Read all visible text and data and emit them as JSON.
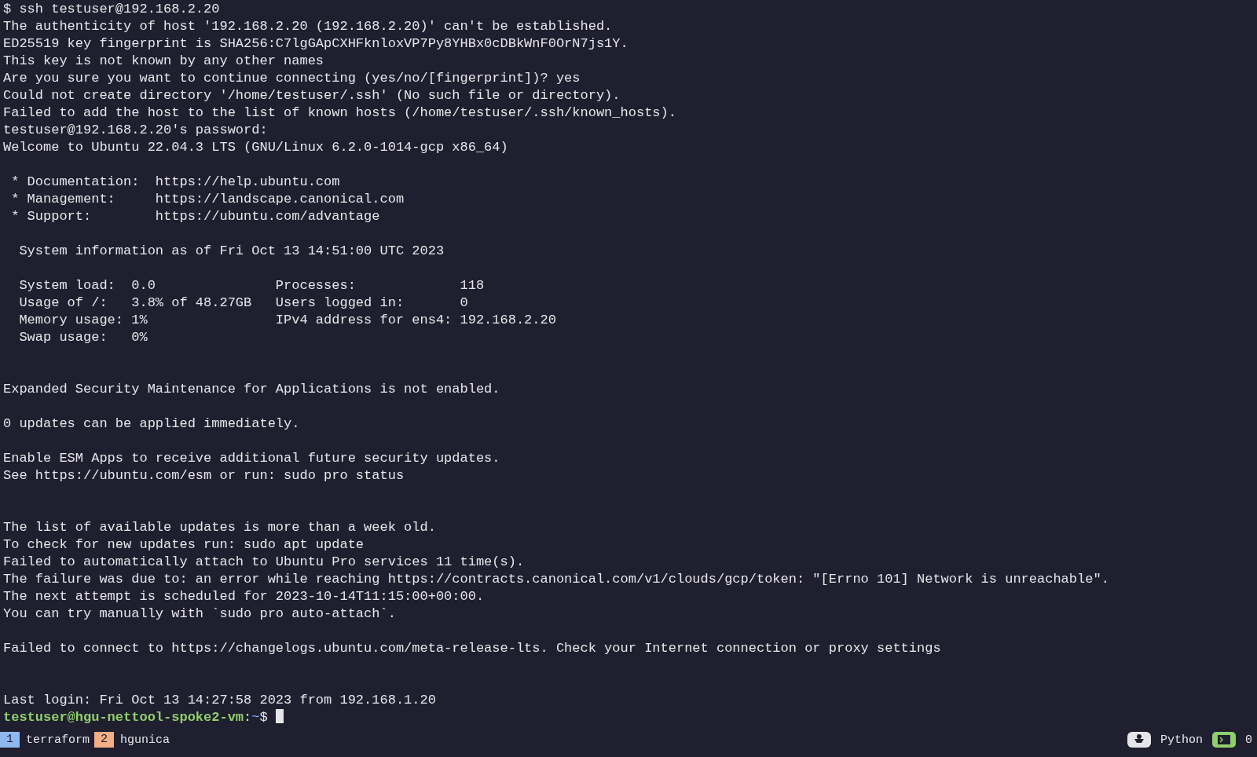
{
  "terminal": {
    "lines": [
      {
        "kind": "output",
        "text": "$ ssh testuser@192.168.2.20"
      },
      {
        "kind": "output",
        "text": "The authenticity of host '192.168.2.20 (192.168.2.20)' can't be established."
      },
      {
        "kind": "output",
        "text": "ED25519 key fingerprint is SHA256:C7lgGApCXHFknloxVP7Py8YHBx0cDBkWnF0OrN7js1Y."
      },
      {
        "kind": "output",
        "text": "This key is not known by any other names"
      },
      {
        "kind": "output",
        "text": "Are you sure you want to continue connecting (yes/no/[fingerprint])? yes"
      },
      {
        "kind": "output",
        "text": "Could not create directory '/home/testuser/.ssh' (No such file or directory)."
      },
      {
        "kind": "output",
        "text": "Failed to add the host to the list of known hosts (/home/testuser/.ssh/known_hosts)."
      },
      {
        "kind": "output",
        "text": "testuser@192.168.2.20's password:"
      },
      {
        "kind": "output",
        "text": "Welcome to Ubuntu 22.04.3 LTS (GNU/Linux 6.2.0-1014-gcp x86_64)"
      },
      {
        "kind": "blank"
      },
      {
        "kind": "output",
        "text": " * Documentation:  https://help.ubuntu.com"
      },
      {
        "kind": "output",
        "text": " * Management:     https://landscape.canonical.com"
      },
      {
        "kind": "output",
        "text": " * Support:        https://ubuntu.com/advantage"
      },
      {
        "kind": "blank"
      },
      {
        "kind": "output",
        "text": "  System information as of Fri Oct 13 14:51:00 UTC 2023"
      },
      {
        "kind": "blank"
      },
      {
        "kind": "output",
        "text": "  System load:  0.0               Processes:             118"
      },
      {
        "kind": "output",
        "text": "  Usage of /:   3.8% of 48.27GB   Users logged in:       0"
      },
      {
        "kind": "output",
        "text": "  Memory usage: 1%                IPv4 address for ens4: 192.168.2.20"
      },
      {
        "kind": "output",
        "text": "  Swap usage:   0%"
      },
      {
        "kind": "blank"
      },
      {
        "kind": "blank"
      },
      {
        "kind": "output",
        "text": "Expanded Security Maintenance for Applications is not enabled."
      },
      {
        "kind": "blank"
      },
      {
        "kind": "output",
        "text": "0 updates can be applied immediately."
      },
      {
        "kind": "blank"
      },
      {
        "kind": "output",
        "text": "Enable ESM Apps to receive additional future security updates."
      },
      {
        "kind": "output",
        "text": "See https://ubuntu.com/esm or run: sudo pro status"
      },
      {
        "kind": "blank"
      },
      {
        "kind": "blank"
      },
      {
        "kind": "output",
        "text": "The list of available updates is more than a week old."
      },
      {
        "kind": "output",
        "text": "To check for new updates run: sudo apt update"
      },
      {
        "kind": "output",
        "text": "Failed to automatically attach to Ubuntu Pro services 11 time(s)."
      },
      {
        "kind": "output",
        "text": "The failure was due to: an error while reaching https://contracts.canonical.com/v1/clouds/gcp/token: \"[Errno 101] Network is unreachable\"."
      },
      {
        "kind": "output",
        "text": "The next attempt is scheduled for 2023-10-14T11:15:00+00:00."
      },
      {
        "kind": "output",
        "text": "You can try manually with `sudo pro auto-attach`."
      },
      {
        "kind": "blank"
      },
      {
        "kind": "output",
        "text": "Failed to connect to https://changelogs.ubuntu.com/meta-release-lts. Check your Internet connection or proxy settings"
      },
      {
        "kind": "blank"
      },
      {
        "kind": "blank"
      },
      {
        "kind": "output",
        "text": "Last login: Fri Oct 13 14:27:58 2023 from 192.168.1.20"
      },
      {
        "kind": "prompt",
        "user_host": "testuser@hgu-nettool-spoke2-vm",
        "separator": ":",
        "path": "~",
        "symbol": "$"
      }
    ]
  },
  "status_bar": {
    "windows": [
      {
        "index": "1",
        "name": "terraform",
        "color": "#8fb8f0"
      },
      {
        "index": "2",
        "name": "hgunica",
        "color": "#f5ad84"
      }
    ],
    "right": [
      {
        "kind": "person"
      },
      {
        "kind": "text",
        "text": "Python"
      },
      {
        "kind": "terminal"
      },
      {
        "kind": "text",
        "text": "0"
      }
    ]
  }
}
